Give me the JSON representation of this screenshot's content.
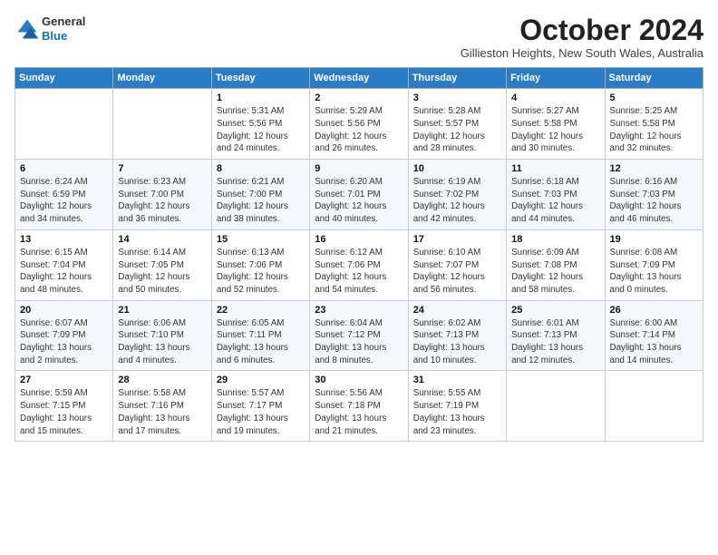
{
  "logo": {
    "general": "General",
    "blue": "Blue"
  },
  "title": "October 2024",
  "location": "Gillieston Heights, New South Wales, Australia",
  "days_header": [
    "Sunday",
    "Monday",
    "Tuesday",
    "Wednesday",
    "Thursday",
    "Friday",
    "Saturday"
  ],
  "weeks": [
    [
      {
        "day": "",
        "info": ""
      },
      {
        "day": "",
        "info": ""
      },
      {
        "day": "1",
        "info": "Sunrise: 5:31 AM\nSunset: 5:56 PM\nDaylight: 12 hours\nand 24 minutes."
      },
      {
        "day": "2",
        "info": "Sunrise: 5:29 AM\nSunset: 5:56 PM\nDaylight: 12 hours\nand 26 minutes."
      },
      {
        "day": "3",
        "info": "Sunrise: 5:28 AM\nSunset: 5:57 PM\nDaylight: 12 hours\nand 28 minutes."
      },
      {
        "day": "4",
        "info": "Sunrise: 5:27 AM\nSunset: 5:58 PM\nDaylight: 12 hours\nand 30 minutes."
      },
      {
        "day": "5",
        "info": "Sunrise: 5:25 AM\nSunset: 5:58 PM\nDaylight: 12 hours\nand 32 minutes."
      }
    ],
    [
      {
        "day": "6",
        "info": "Sunrise: 6:24 AM\nSunset: 6:59 PM\nDaylight: 12 hours\nand 34 minutes."
      },
      {
        "day": "7",
        "info": "Sunrise: 6:23 AM\nSunset: 7:00 PM\nDaylight: 12 hours\nand 36 minutes."
      },
      {
        "day": "8",
        "info": "Sunrise: 6:21 AM\nSunset: 7:00 PM\nDaylight: 12 hours\nand 38 minutes."
      },
      {
        "day": "9",
        "info": "Sunrise: 6:20 AM\nSunset: 7:01 PM\nDaylight: 12 hours\nand 40 minutes."
      },
      {
        "day": "10",
        "info": "Sunrise: 6:19 AM\nSunset: 7:02 PM\nDaylight: 12 hours\nand 42 minutes."
      },
      {
        "day": "11",
        "info": "Sunrise: 6:18 AM\nSunset: 7:03 PM\nDaylight: 12 hours\nand 44 minutes."
      },
      {
        "day": "12",
        "info": "Sunrise: 6:16 AM\nSunset: 7:03 PM\nDaylight: 12 hours\nand 46 minutes."
      }
    ],
    [
      {
        "day": "13",
        "info": "Sunrise: 6:15 AM\nSunset: 7:04 PM\nDaylight: 12 hours\nand 48 minutes."
      },
      {
        "day": "14",
        "info": "Sunrise: 6:14 AM\nSunset: 7:05 PM\nDaylight: 12 hours\nand 50 minutes."
      },
      {
        "day": "15",
        "info": "Sunrise: 6:13 AM\nSunset: 7:06 PM\nDaylight: 12 hours\nand 52 minutes."
      },
      {
        "day": "16",
        "info": "Sunrise: 6:12 AM\nSunset: 7:06 PM\nDaylight: 12 hours\nand 54 minutes."
      },
      {
        "day": "17",
        "info": "Sunrise: 6:10 AM\nSunset: 7:07 PM\nDaylight: 12 hours\nand 56 minutes."
      },
      {
        "day": "18",
        "info": "Sunrise: 6:09 AM\nSunset: 7:08 PM\nDaylight: 12 hours\nand 58 minutes."
      },
      {
        "day": "19",
        "info": "Sunrise: 6:08 AM\nSunset: 7:09 PM\nDaylight: 13 hours\nand 0 minutes."
      }
    ],
    [
      {
        "day": "20",
        "info": "Sunrise: 6:07 AM\nSunset: 7:09 PM\nDaylight: 13 hours\nand 2 minutes."
      },
      {
        "day": "21",
        "info": "Sunrise: 6:06 AM\nSunset: 7:10 PM\nDaylight: 13 hours\nand 4 minutes."
      },
      {
        "day": "22",
        "info": "Sunrise: 6:05 AM\nSunset: 7:11 PM\nDaylight: 13 hours\nand 6 minutes."
      },
      {
        "day": "23",
        "info": "Sunrise: 6:04 AM\nSunset: 7:12 PM\nDaylight: 13 hours\nand 8 minutes."
      },
      {
        "day": "24",
        "info": "Sunrise: 6:02 AM\nSunset: 7:13 PM\nDaylight: 13 hours\nand 10 minutes."
      },
      {
        "day": "25",
        "info": "Sunrise: 6:01 AM\nSunset: 7:13 PM\nDaylight: 13 hours\nand 12 minutes."
      },
      {
        "day": "26",
        "info": "Sunrise: 6:00 AM\nSunset: 7:14 PM\nDaylight: 13 hours\nand 14 minutes."
      }
    ],
    [
      {
        "day": "27",
        "info": "Sunrise: 5:59 AM\nSunset: 7:15 PM\nDaylight: 13 hours\nand 15 minutes."
      },
      {
        "day": "28",
        "info": "Sunrise: 5:58 AM\nSunset: 7:16 PM\nDaylight: 13 hours\nand 17 minutes."
      },
      {
        "day": "29",
        "info": "Sunrise: 5:57 AM\nSunset: 7:17 PM\nDaylight: 13 hours\nand 19 minutes."
      },
      {
        "day": "30",
        "info": "Sunrise: 5:56 AM\nSunset: 7:18 PM\nDaylight: 13 hours\nand 21 minutes."
      },
      {
        "day": "31",
        "info": "Sunrise: 5:55 AM\nSunset: 7:19 PM\nDaylight: 13 hours\nand 23 minutes."
      },
      {
        "day": "",
        "info": ""
      },
      {
        "day": "",
        "info": ""
      }
    ]
  ]
}
